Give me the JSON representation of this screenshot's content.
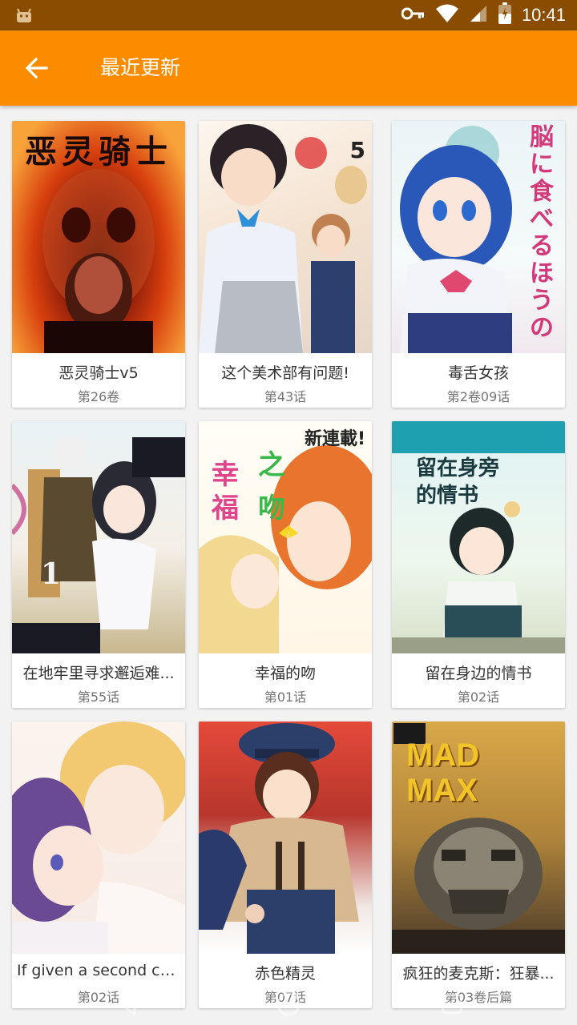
{
  "status_bar": {
    "time": "10:41",
    "icons": [
      "android-icon",
      "key-icon",
      "wifi-icon",
      "signal-icon",
      "battery-icon"
    ]
  },
  "app_bar": {
    "title": "最近更新",
    "back_icon": "arrow-left-icon",
    "color": "#fb8c00"
  },
  "cards": [
    {
      "title": "恶灵骑士v5",
      "subtitle": "第26卷",
      "cover_text": "恶灵骑士"
    },
    {
      "title": "这个美术部有问题!",
      "subtitle": "第43话",
      "cover_text": "5"
    },
    {
      "title": "毒舌女孩",
      "subtitle": "第2卷09话",
      "cover_text": "脳に食べるほうの"
    },
    {
      "title": "在地牢里寻求邂逅难...",
      "subtitle": "第55话",
      "cover_text": "1"
    },
    {
      "title": "幸福的吻",
      "subtitle": "第01话",
      "cover_text": "新連載!"
    },
    {
      "title": "留在身边的情书",
      "subtitle": "第02话",
      "cover_text": "留在身旁的情书"
    },
    {
      "title": "If given a second ch...",
      "subtitle": "第02话",
      "cover_text": ""
    },
    {
      "title": "赤色精灵",
      "subtitle": "第07话",
      "cover_text": ""
    },
    {
      "title": "疯狂的麦克斯：狂暴...",
      "subtitle": "第03卷后篇",
      "cover_text": "MAD MAX"
    }
  ],
  "nav_bar": {
    "icons": [
      "nav-back-icon",
      "nav-home-icon",
      "nav-recents-icon"
    ]
  }
}
